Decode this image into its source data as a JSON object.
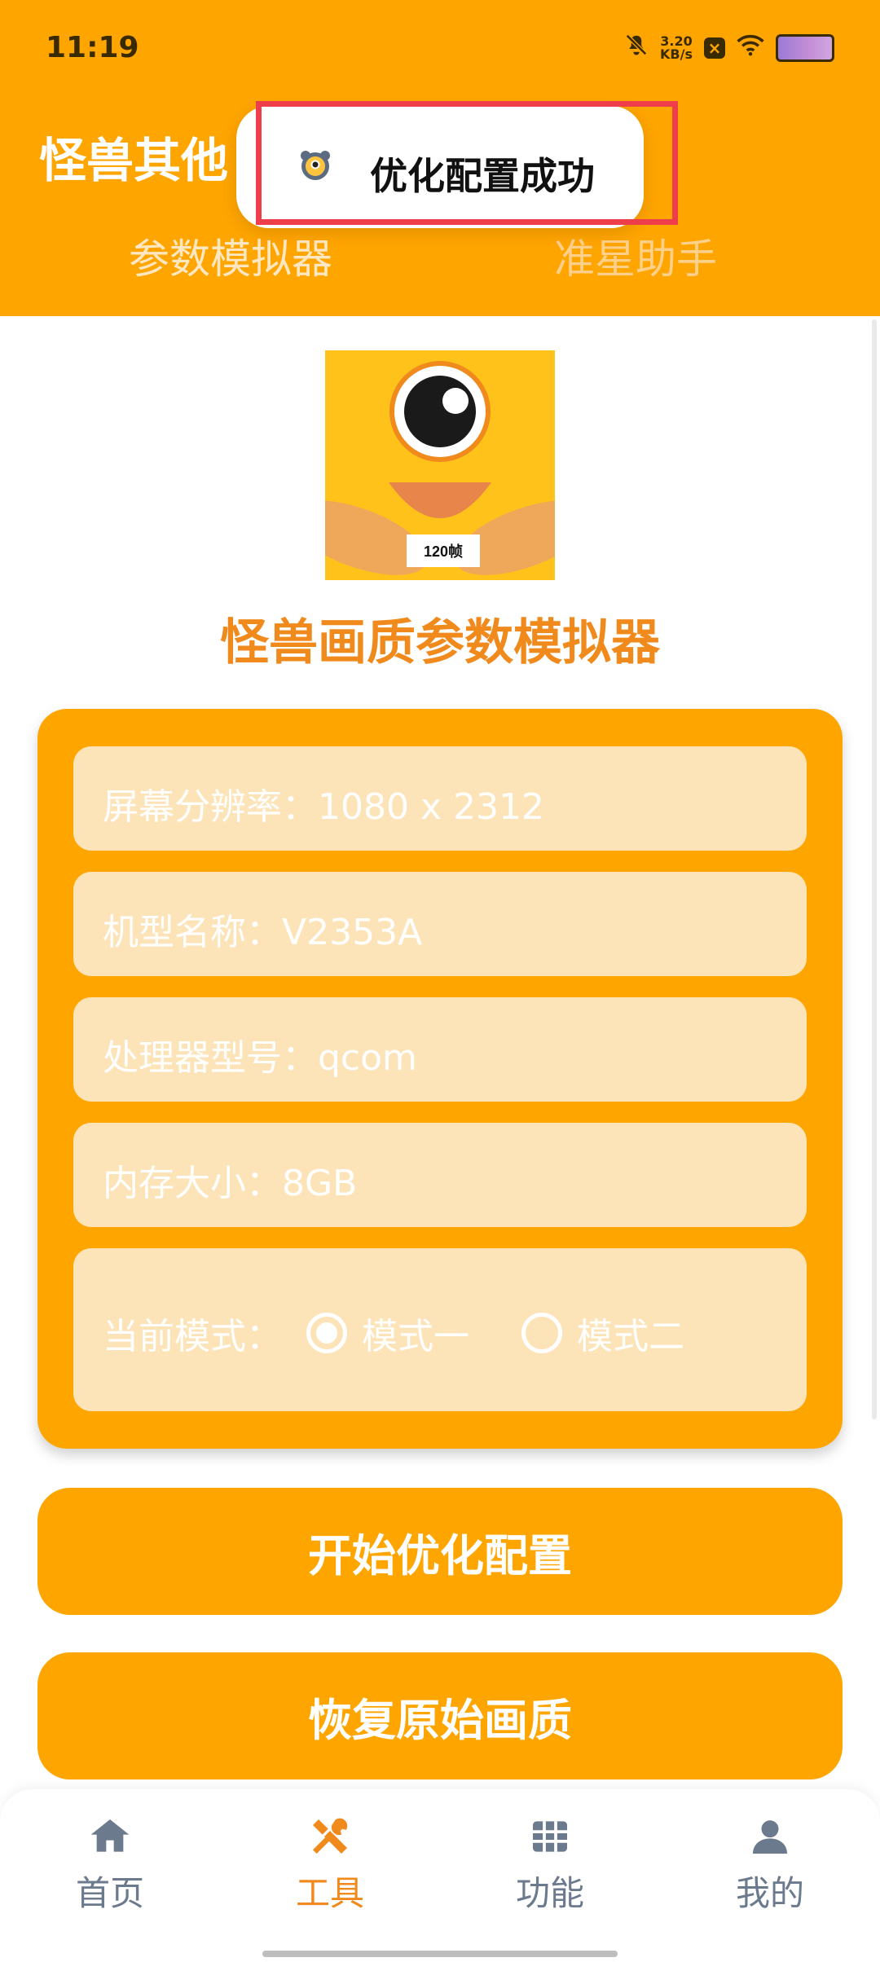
{
  "status_bar": {
    "time": "11:19",
    "netspeed_value": "3.20",
    "netspeed_unit": "KB/s"
  },
  "header": {
    "title": "怪兽其他",
    "tabs": [
      "参数模拟器",
      "准星助手"
    ]
  },
  "toast": {
    "message": "优化配置成功"
  },
  "main": {
    "logo_label": "120帧",
    "title": "怪兽画质参数模拟器",
    "fields": [
      {
        "label": "屏幕分辨率：1080 x 2312"
      },
      {
        "label": "机型名称：V2353A"
      },
      {
        "label": "处理器型号：qcom"
      },
      {
        "label": "内存大小：8GB"
      }
    ],
    "mode": {
      "label": "当前模式：",
      "options": [
        {
          "label": "模式一",
          "selected": true
        },
        {
          "label": "模式二",
          "selected": false
        }
      ]
    },
    "buttons": {
      "optimize": "开始优化配置",
      "restore": "恢复原始画质"
    }
  },
  "bottom_nav": {
    "items": [
      {
        "label": "首页",
        "icon": "home-icon",
        "active": false
      },
      {
        "label": "工具",
        "icon": "tools-icon",
        "active": true
      },
      {
        "label": "功能",
        "icon": "grid-icon",
        "active": false
      },
      {
        "label": "我的",
        "icon": "person-icon",
        "active": false
      }
    ]
  },
  "colors": {
    "primary": "#FFA500",
    "accent_text": "#F08A1C",
    "field_bg": "#FDE4B8",
    "highlight": "#EE3D4B",
    "nav_inactive": "#6B7A8D"
  }
}
